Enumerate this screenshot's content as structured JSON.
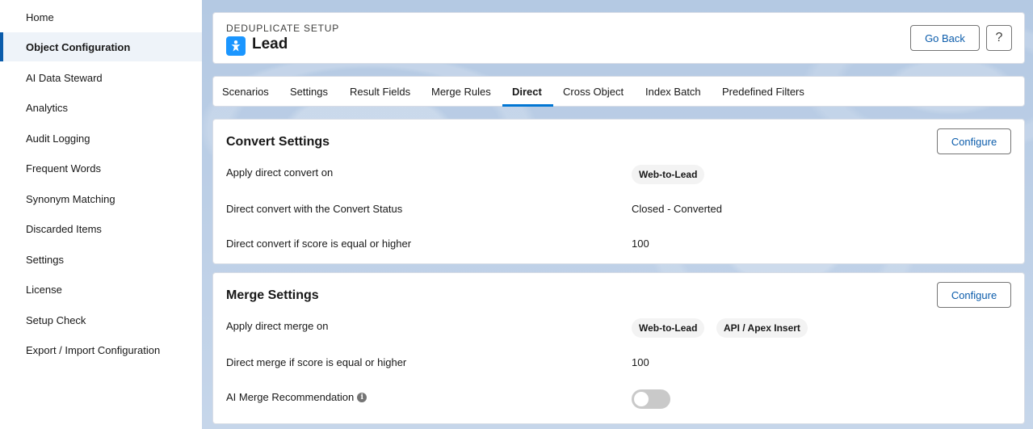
{
  "sidebar": {
    "items": [
      {
        "label": "Home"
      },
      {
        "label": "Object Configuration",
        "active": true
      },
      {
        "label": "AI Data Steward"
      },
      {
        "label": "Analytics"
      },
      {
        "label": "Audit Logging"
      },
      {
        "label": "Frequent Words"
      },
      {
        "label": "Synonym Matching"
      },
      {
        "label": "Discarded Items"
      },
      {
        "label": "Settings"
      },
      {
        "label": "License"
      },
      {
        "label": "Setup Check"
      },
      {
        "label": "Export / Import Configuration"
      }
    ]
  },
  "header": {
    "eyebrow": "DEDUPLICATE SETUP",
    "title": "Lead",
    "icon": "lead-person-icon",
    "go_back_label": "Go Back",
    "help_label": "?"
  },
  "tabs": [
    {
      "label": "Scenarios"
    },
    {
      "label": "Settings"
    },
    {
      "label": "Result Fields"
    },
    {
      "label": "Merge Rules"
    },
    {
      "label": "Direct",
      "active": true
    },
    {
      "label": "Cross Object"
    },
    {
      "label": "Index Batch"
    },
    {
      "label": "Predefined Filters"
    }
  ],
  "convert_settings": {
    "title": "Convert Settings",
    "configure_label": "Configure",
    "rows": [
      {
        "label": "Apply direct convert on",
        "pills": [
          "Web-to-Lead"
        ]
      },
      {
        "label": "Direct convert with the Convert Status",
        "value": "Closed - Converted"
      },
      {
        "label": "Direct convert if score is equal or higher",
        "value": "100"
      }
    ]
  },
  "merge_settings": {
    "title": "Merge Settings",
    "configure_label": "Configure",
    "rows": [
      {
        "label": "Apply direct merge on",
        "pills": [
          "Web-to-Lead",
          "API / Apex Insert"
        ]
      },
      {
        "label": "Direct merge if score is equal or higher",
        "value": "100"
      },
      {
        "label": "AI Merge Recommendation",
        "info_icon": "i",
        "toggle_on": false
      }
    ]
  },
  "colors": {
    "brand_blue": "#0176d3",
    "link_blue": "#0b5cab",
    "lead_icon_bg": "#1b96ff"
  }
}
